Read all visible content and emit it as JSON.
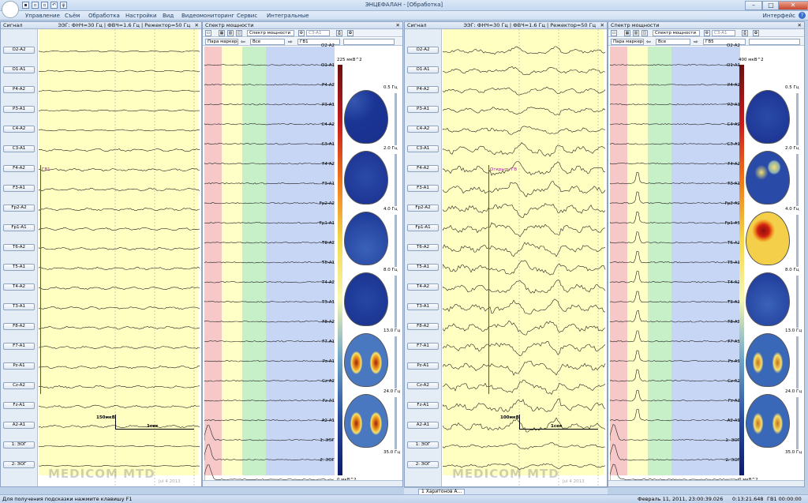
{
  "app": {
    "title": "ЭНЦЕФАЛАН - [Обработка]"
  },
  "menu": [
    "Управление",
    "Съём",
    "Обработка",
    "Настройки",
    "Вид",
    "Видеомониторинг",
    "Сервис",
    "Интегральные"
  ],
  "interface_label": "Интерфейс",
  "help_icon": "?",
  "panels": [
    {
      "signal": {
        "header": "Сигнал",
        "info": "ЭЭГ: ФНЧ=30 Гц | ФВЧ=1.6 Гц | Режектор=50 Гц",
        "marker": "ГВ1",
        "scale_amp": "150мкВ",
        "scale_time": "1сек"
      },
      "spectrum": {
        "header": "Спектр мощности",
        "mode": "Спектр мощности",
        "lead": "C3-A1",
        "pair": "Пара маркеров",
        "all": "Все",
        "marker": "ГВ1",
        "max": "225 мкВ^2",
        "min": "0 мкВ^2",
        "freqs": [
          "0.5 Гц",
          "2.0 Гц",
          "4.0 Гц",
          "8.0 Гц",
          "13.0 Гц",
          "24.0 Гц",
          "35.0 Гц"
        ]
      },
      "watermark": "MEDICOM MTD",
      "date": "Jul 4 2013"
    },
    {
      "signal": {
        "header": "Сигнал",
        "info": "ЭЭГ: ФНЧ=30 Гц | ФВЧ=1.6 Гц | Режектор=50 Гц",
        "marker": "Открыть ГВ",
        "scale_amp": "100мкВ",
        "scale_time": "1сек"
      },
      "spectrum": {
        "header": "Спектр мощности",
        "mode": "Спектр мощности",
        "lead": "C3-A1",
        "pair": "Пара маркеров",
        "all": "Все",
        "marker": "ГВ5",
        "max": "400 мкВ^2",
        "min": "0 мкВ^2",
        "freqs": [
          "0.5 Гц",
          "2.0 Гц",
          "4.0 Гц",
          "8.0 Гц",
          "13.0 Гц",
          "24.0 Гц",
          "35.0 Гц"
        ]
      },
      "watermark": "MEDICOM MTD",
      "date": "Jul 4 2013"
    }
  ],
  "channels": [
    "O2-A2",
    "O1-A1",
    "P4-A2",
    "P3-A1",
    "C4-A2",
    "C3-A1",
    "F4-A2",
    "F3-A1",
    "Fp2-A2",
    "Fp1-A1",
    "T6-A2",
    "T5-A1",
    "T4-A2",
    "T3-A1",
    "F8-A2",
    "F7-A1",
    "Pz-A1",
    "Cz-A2",
    "Fz-A1",
    "A2-A1",
    "1: ЭОГ",
    "2: ЭОГ"
  ],
  "tab": "1 Харитонов А...",
  "status": {
    "hint": "Для получения подсказки нажмите клавишу F1",
    "datetime": "Февраль 11, 2011, 23:00:39.026",
    "time1": "0:13:21.648",
    "marker": "ГВ1 00:00:00"
  },
  "colors": {
    "yellow": "#ffffc2",
    "red_band": "#f6c8c8",
    "yellow_band": "#ffffc8",
    "green_band": "#c8f0c8",
    "blue_band": "#c8d6f6"
  }
}
